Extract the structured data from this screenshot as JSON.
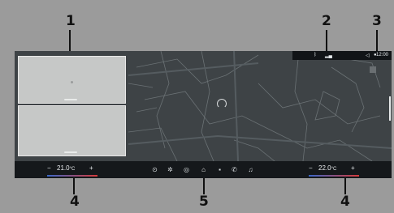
{
  "callouts": {
    "c1": "1",
    "c2": "2",
    "c3": "3",
    "c4a": "4",
    "c4b": "4",
    "c5": "5"
  },
  "status": {
    "time": "12:00"
  },
  "climate": {
    "left": {
      "minus": "−",
      "value": "21.0",
      "unit": "°C",
      "plus": "+"
    },
    "right": {
      "minus": "−",
      "value": "22.0",
      "unit": "°C",
      "plus": "+"
    }
  },
  "dock_icons": [
    "navigation-icon",
    "fan-icon",
    "media-icon",
    "home-icon",
    "apps-icon",
    "phone-icon",
    "music-icon"
  ],
  "colors": {
    "screen": "#3e4346",
    "bar": "#15181b",
    "widget": "#c6c8c7"
  }
}
